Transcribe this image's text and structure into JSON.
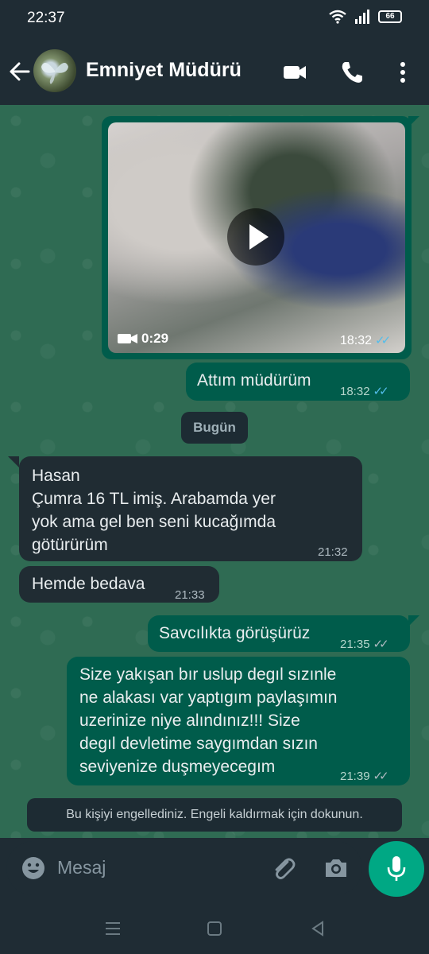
{
  "status_bar": {
    "time": "22:37",
    "battery": "66"
  },
  "header": {
    "contact_name": "Emniyet Müdürü"
  },
  "video_message": {
    "duration": "0:29",
    "time": "18:32"
  },
  "messages": [
    {
      "direction": "out",
      "text": "Attım müdürüm",
      "time": "18:32",
      "status": "read"
    },
    {
      "direction": "in",
      "lines": [
        "Hasan",
        "Çumra 16 TL imiş. Arabamda yer",
        "yok ama gel ben seni kucağımda",
        "götürürüm"
      ],
      "time": "21:32"
    },
    {
      "direction": "in",
      "text": "Hemde bedava",
      "time": "21:33"
    },
    {
      "direction": "out",
      "text": "Savcılıkta görüşürüz",
      "time": "21:35",
      "status": "delivered"
    },
    {
      "direction": "out",
      "lines": [
        "Size yakışan bır uslup degıl sızınle",
        "ne alakası var yaptıgım paylaşımın",
        "uzerinize niye alındınız!!! Size",
        "degıl devletime saygımdan sızın",
        "seviyenize duşmeyecegım"
      ],
      "time": "21:39",
      "status": "delivered"
    }
  ],
  "date_divider": "Bugün",
  "blocked_notice": "Bu kişiyi engellediniz. Engeli kaldırmak için dokunun.",
  "composer": {
    "placeholder": "Mesaj"
  },
  "colors": {
    "header_bg": "#1f2c34",
    "chat_bg": "#2f6b53",
    "outgoing_bubble": "#005c4b",
    "incoming_bubble": "#202c33",
    "read_ticks": "#53bdeb",
    "mic_button": "#00a884"
  },
  "icons": [
    "back-arrow-icon",
    "video-call-icon",
    "phone-icon",
    "more-vert-icon",
    "play-icon",
    "videocam-icon",
    "emoji-icon",
    "attach-icon",
    "camera-icon",
    "mic-icon",
    "recents-icon",
    "home-icon",
    "back-nav-icon",
    "wifi-icon",
    "signal-icon",
    "battery-icon"
  ]
}
